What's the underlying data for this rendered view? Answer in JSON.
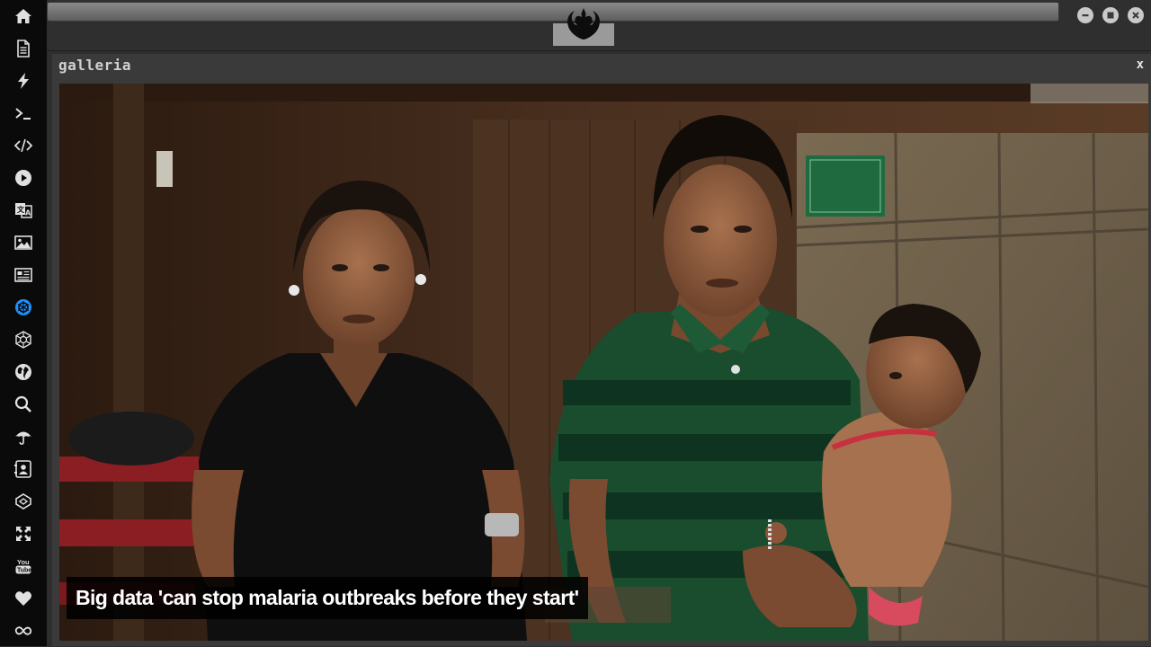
{
  "dock": {
    "items": [
      {
        "name": "home-icon",
        "label": "home"
      },
      {
        "name": "document-icon",
        "label": "document"
      },
      {
        "name": "lightning-icon",
        "label": "lightning"
      },
      {
        "name": "terminal-icon",
        "label": "terminal"
      },
      {
        "name": "code-icon",
        "label": "code"
      },
      {
        "name": "play-icon",
        "label": "play"
      },
      {
        "name": "translate-icon",
        "label": "translate"
      },
      {
        "name": "image-icon",
        "label": "image"
      },
      {
        "name": "newspaper-icon",
        "label": "newspaper"
      },
      {
        "name": "rebel-alliance-icon",
        "label": "rebel alliance",
        "active": true
      },
      {
        "name": "empire-icon",
        "label": "empire"
      },
      {
        "name": "globe-icon",
        "label": "globe"
      },
      {
        "name": "search-icon",
        "label": "search"
      },
      {
        "name": "umbrella-icon",
        "label": "umbrella"
      },
      {
        "name": "contact-card-icon",
        "label": "contact card"
      },
      {
        "name": "codepen-icon",
        "label": "codepen"
      },
      {
        "name": "expand-icon",
        "label": "expand"
      },
      {
        "name": "youtube-icon",
        "label": "YouTube"
      },
      {
        "name": "heart-icon",
        "label": "heart"
      },
      {
        "name": "infinity-icon",
        "label": "infinity"
      }
    ],
    "active_color": "#1e90ff",
    "icon_color": "#e0e0e0"
  },
  "topbar": {
    "logo_icon": "rebel-alliance-icon",
    "window_buttons": [
      "minimize-icon",
      "maximize-icon",
      "close-icon"
    ]
  },
  "window": {
    "title": "galleria",
    "close_label": "x"
  },
  "gallery": {
    "caption": "Big data 'can stop malaria outbreaks before they start'",
    "photo_description_icon": "photo"
  }
}
